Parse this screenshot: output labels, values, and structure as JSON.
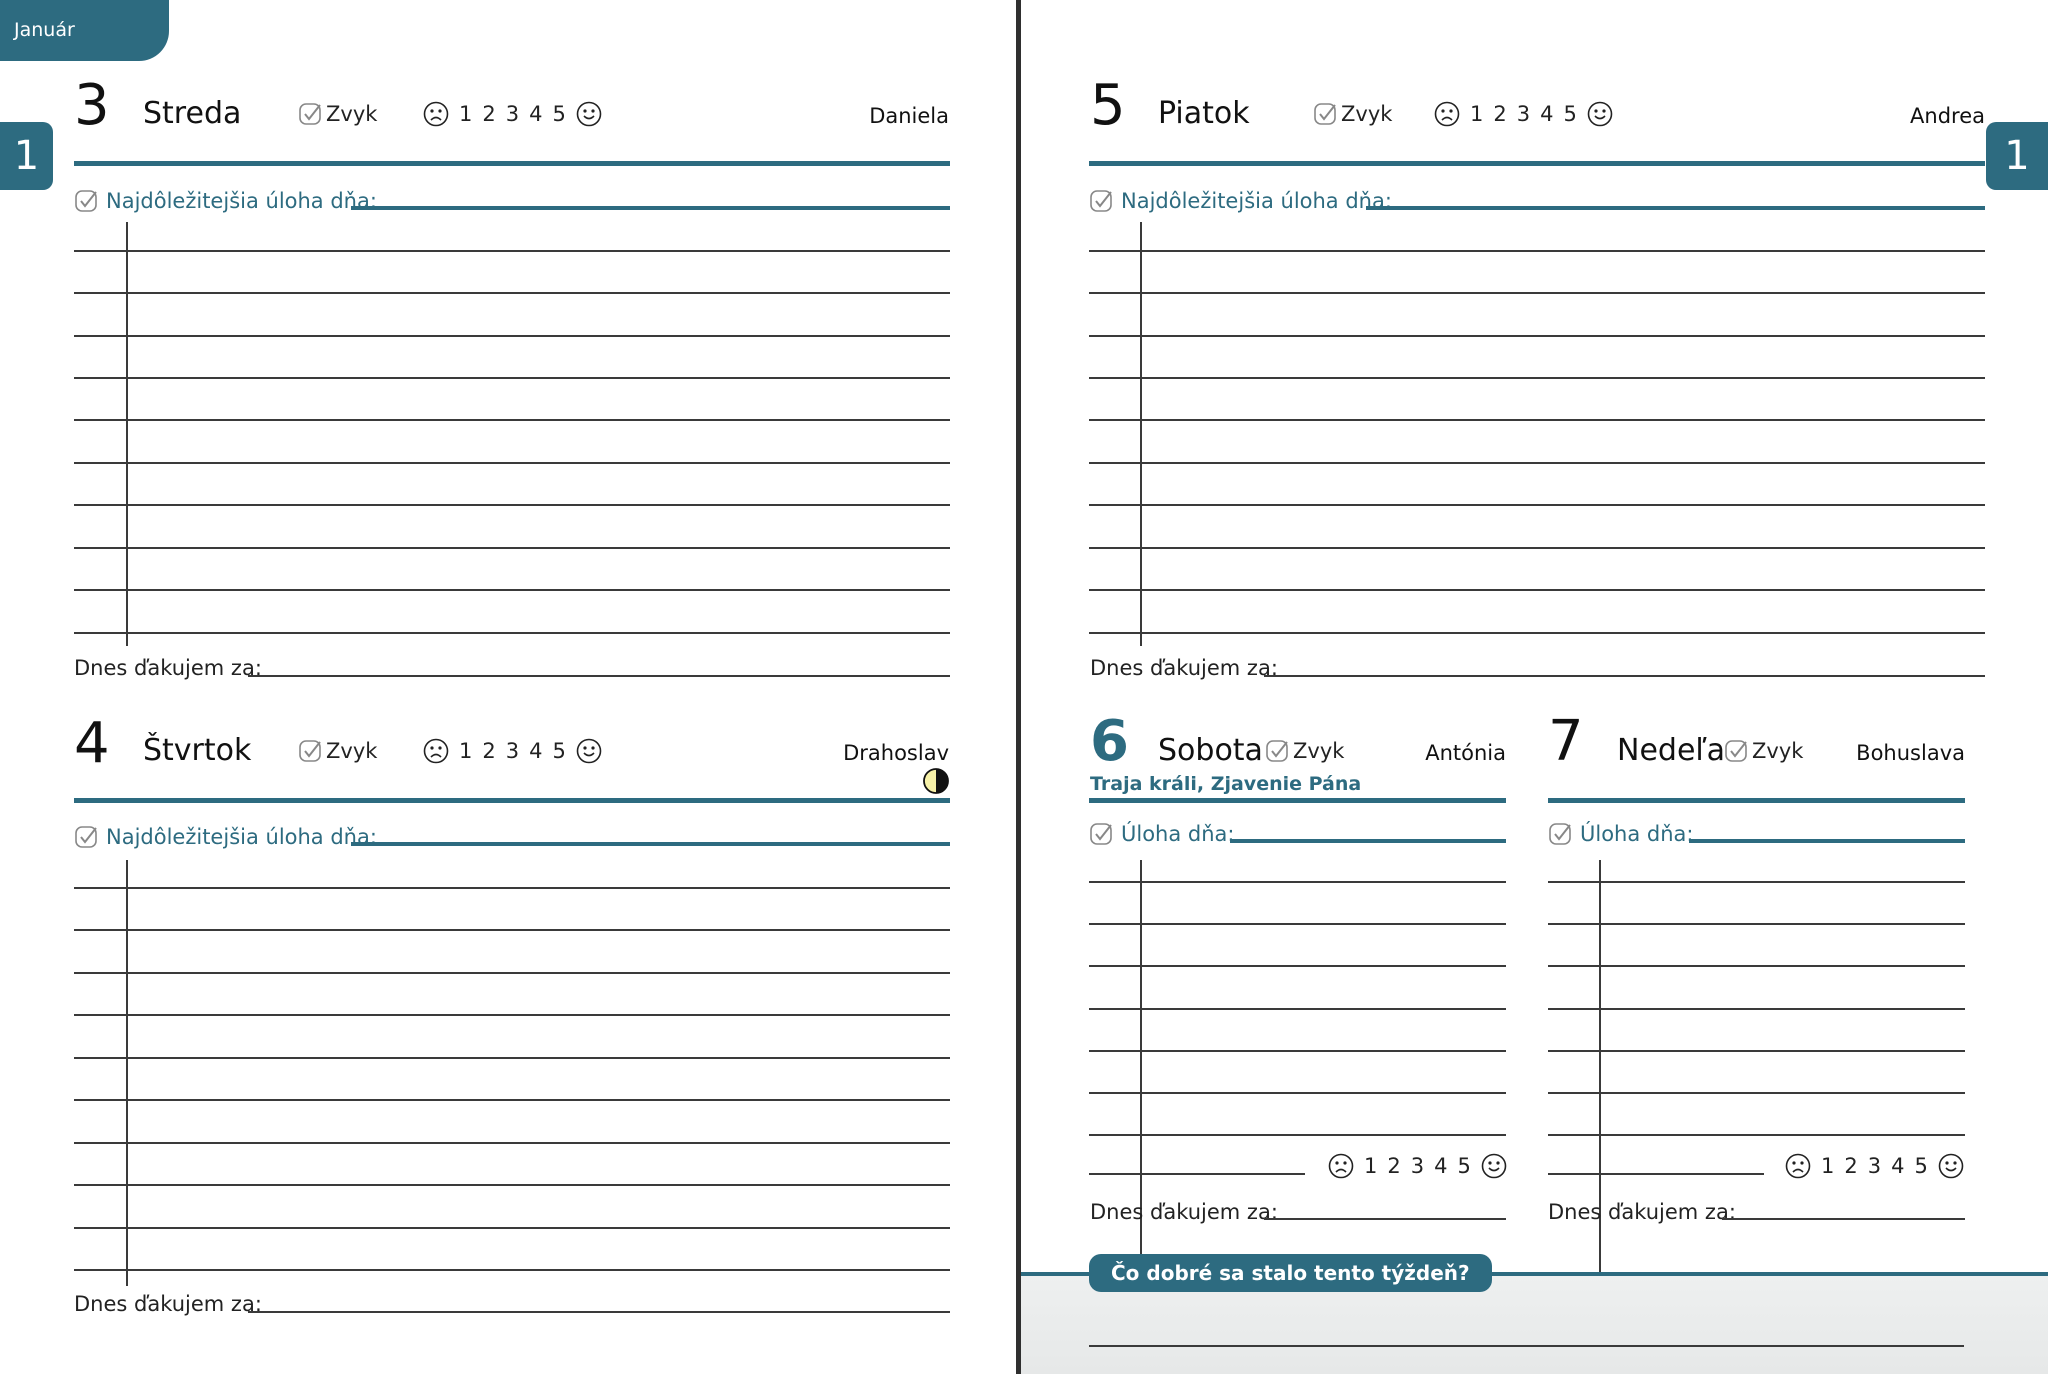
{
  "month": "Január",
  "week_number": "1",
  "labels": {
    "habit": "Zvyk",
    "most_important_task": "Najdôležitejšia úloha dňa:",
    "task_of_day": "Úloha dňa:",
    "thanks": "Dnes ďakujem za:",
    "mood_scale": [
      "1",
      "2",
      "3",
      "4",
      "5"
    ]
  },
  "days": {
    "d3": {
      "number": "3",
      "name": "Streda",
      "nameday": "Daniela"
    },
    "d4": {
      "number": "4",
      "name": "Štvrtok",
      "nameday": "Drahoslav",
      "moon_phase": "first-quarter-moon-icon"
    },
    "d5": {
      "number": "5",
      "name": "Piatok",
      "nameday": "Andrea"
    },
    "d6": {
      "number": "6",
      "name": "Sobota",
      "nameday": "Antónia",
      "holiday": "Traja králi, Zjavenie Pána"
    },
    "d7": {
      "number": "7",
      "name": "Nedeľa",
      "nameday": "Bohuslava"
    }
  },
  "week_question": "Čo dobré sa stalo tento týždeň?",
  "colors": {
    "accent": "#2d6b80",
    "rule": "#3a3a3a",
    "spine": "#2f2f2f"
  }
}
